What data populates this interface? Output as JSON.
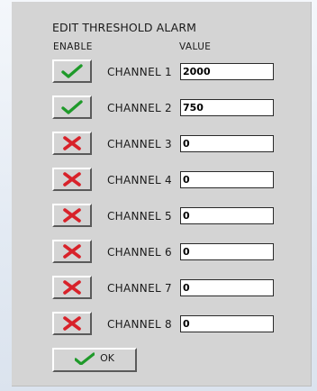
{
  "dialog": {
    "title": "EDIT THRESHOLD ALARM",
    "enable_header": "ENABLE",
    "value_header": "VALUE",
    "ok_label": "OK"
  },
  "colors": {
    "check": "#1f9a2a",
    "cross": "#d8222a",
    "panel": "#d4d4d4"
  },
  "channels": [
    {
      "label": "CHANNEL 1",
      "enabled": true,
      "icon": "check-icon",
      "value": "2000"
    },
    {
      "label": "CHANNEL 2",
      "enabled": true,
      "icon": "check-icon",
      "value": "750"
    },
    {
      "label": "CHANNEL 3",
      "enabled": false,
      "icon": "cross-icon",
      "value": "0"
    },
    {
      "label": "CHANNEL 4",
      "enabled": false,
      "icon": "cross-icon",
      "value": "0"
    },
    {
      "label": "CHANNEL 5",
      "enabled": false,
      "icon": "cross-icon",
      "value": "0"
    },
    {
      "label": "CHANNEL 6",
      "enabled": false,
      "icon": "cross-icon",
      "value": "0"
    },
    {
      "label": "CHANNEL 7",
      "enabled": false,
      "icon": "cross-icon",
      "value": "0"
    },
    {
      "label": "CHANNEL 8",
      "enabled": false,
      "icon": "cross-icon",
      "value": "0"
    }
  ]
}
